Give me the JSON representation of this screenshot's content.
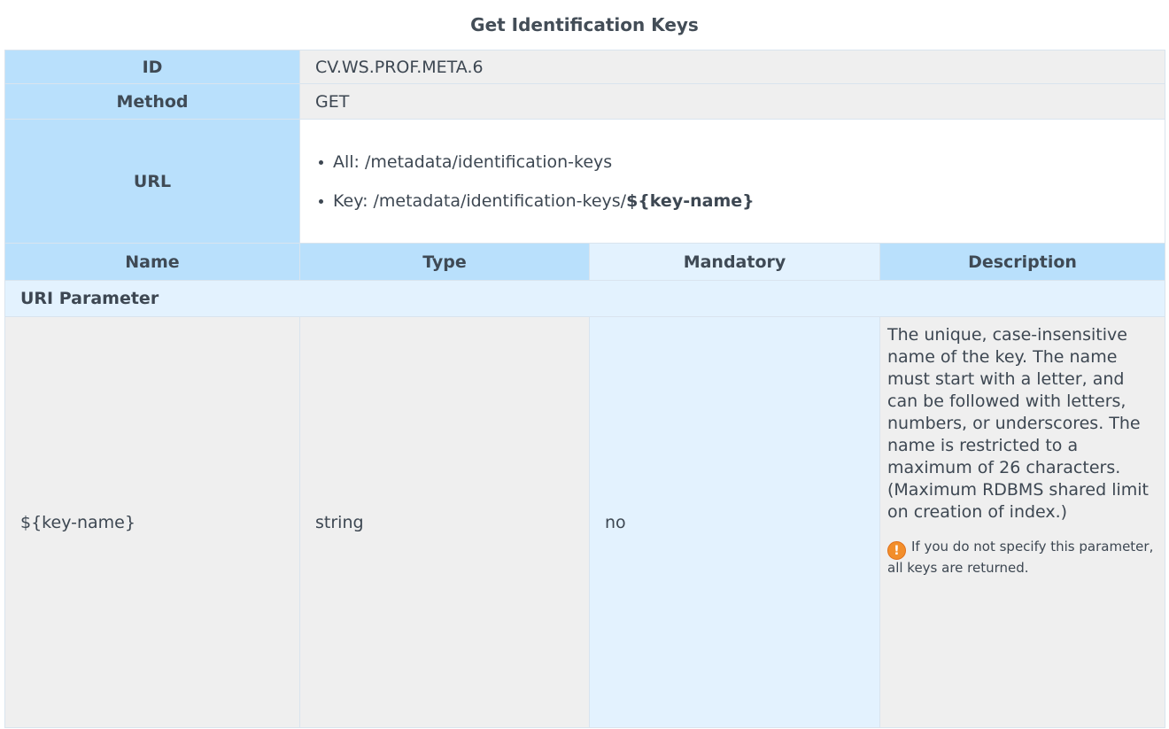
{
  "title": "Get Identification Keys",
  "meta": {
    "id_label": "ID",
    "id_value": "CV.WS.PROF.META.6",
    "method_label": "Method",
    "method_value": "GET",
    "url_label": "URL",
    "urls": [
      {
        "prefix": "All: /metadata/identification-keys",
        "param": ""
      },
      {
        "prefix": "Key: /metadata/identification-keys/",
        "param": "${key-name}"
      }
    ]
  },
  "columns": {
    "name": "Name",
    "type": "Type",
    "mandatory": "Mandatory",
    "description": "Description"
  },
  "section": "URI Parameter",
  "params": [
    {
      "name": "${key-name}",
      "type": "string",
      "mandatory": "no",
      "description": "The unique, case-insensitive name of the key. The name must start with a letter, and can be followed with letters, numbers, or underscores. The name is restricted to a maximum of 26 characters. (Maximum RDBMS shared limit on creation of index.)",
      "note_icon": "exclamation-icon",
      "note": "If you do not specify this parameter, all keys are returned."
    }
  ]
}
